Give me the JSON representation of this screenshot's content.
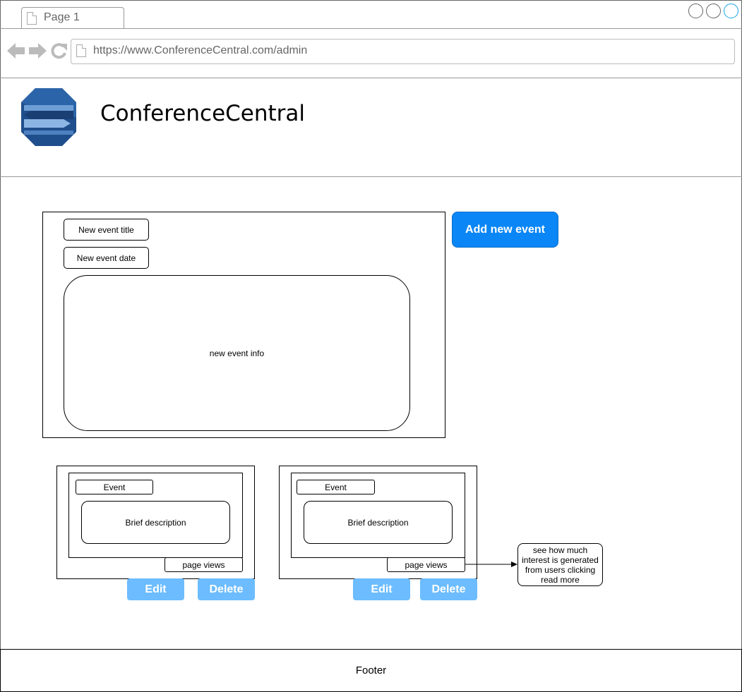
{
  "browser": {
    "tab_label": "Page 1",
    "url": "https://www.ConferenceCentral.com/admin"
  },
  "site": {
    "title": "ConferenceCentral"
  },
  "new_event_form": {
    "title_field": "New event title",
    "date_field": "New event date",
    "info_field": "new event info",
    "add_button": "Add new event"
  },
  "event_cards": [
    {
      "event_label": "Event",
      "description": "Brief description",
      "page_views": "page views",
      "edit_label": "Edit",
      "delete_label": "Delete"
    },
    {
      "event_label": "Event",
      "description": "Brief description",
      "page_views": "page views",
      "edit_label": "Edit",
      "delete_label": "Delete"
    }
  ],
  "annotation": {
    "text": "see how much interest is generated from users clicking read more"
  },
  "footer": {
    "text": "Footer"
  },
  "colors": {
    "primary_button": "#0a86f6",
    "secondary_button": "#6cbcff",
    "logo_dark": "#1f4e8c",
    "logo_light": "#6d9fd6"
  },
  "icons": [
    "document-icon",
    "back-arrow-icon",
    "forward-arrow-icon",
    "reload-icon",
    "window-circle-icon"
  ]
}
